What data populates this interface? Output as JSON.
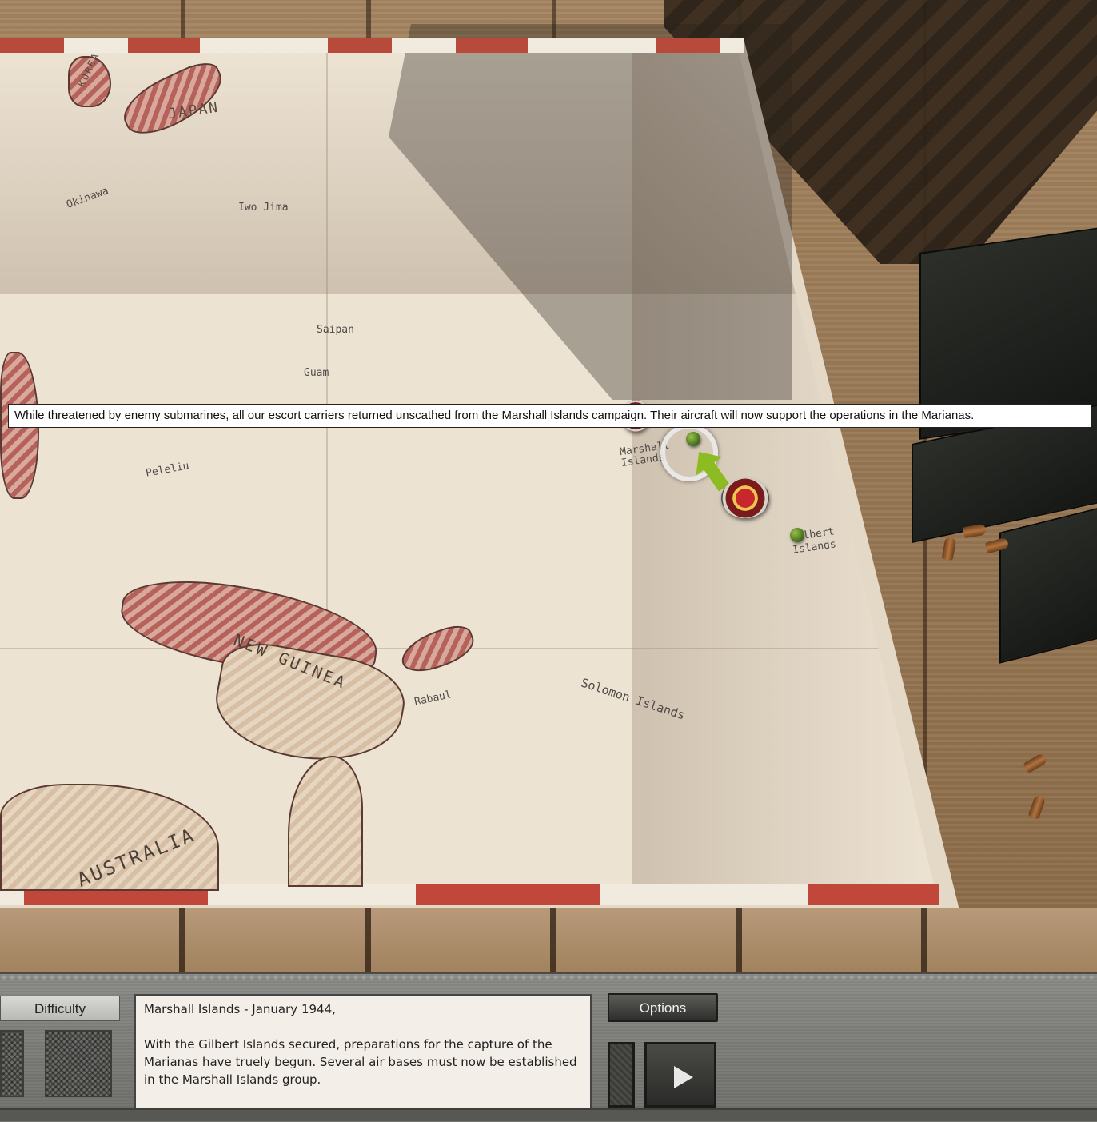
{
  "tooltip": {
    "text": "While threatened by enemy submarines, all our escort carriers returned unscathed from the Marshall Islands campaign. Their aircraft will now support the operations in the Marianas."
  },
  "map": {
    "labels": {
      "korea": "KOREA",
      "japan": "JAPAN",
      "okinawa": "Okinawa",
      "iwo_jima": "Iwo Jima",
      "saipan": "Saipan",
      "guam": "Guam",
      "peleliu": "Peleliu",
      "marshall": "Marshall Islands",
      "gilbert": "Gilbert Islands",
      "new_guinea": "NEW GUINEA",
      "rabaul": "Rabaul",
      "solomon": "Solomon Islands",
      "australia": "AUSTRALIA"
    },
    "icons": [
      "green-pin-icon",
      "marine-corps-seal-icon",
      "selection-ring-icon",
      "advance-arrow-icon"
    ]
  },
  "panel": {
    "difficulty_label": "Difficulty",
    "options_label": "Options",
    "briefing_title": "Marshall Islands - January 1944,",
    "briefing_body": "With the Gilbert Islands secured, preparations for the capture of the Marianas have truely begun. Several air bases must now be established in the Marshall Islands group."
  },
  "colors": {
    "map_paper": "#ede3d3",
    "map_border_red": "#c0473a",
    "marker_green": "#8dbb22",
    "panel_gray": "#7c7c78"
  }
}
